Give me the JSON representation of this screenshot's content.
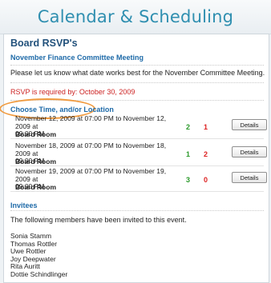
{
  "header": {
    "title": "Calendar & Scheduling"
  },
  "section": {
    "title": "Board RSVP's",
    "event_name": "November Finance Committee Meeting",
    "message": "Please let us know what date works best for the November Committee Meeting.",
    "rsvp_note": "RSVP is required by: October 30, 2009"
  },
  "choose": {
    "label": "Choose Time, and/or Location"
  },
  "options": [
    {
      "range_line1": "November 12, 2009 at 07:00 PM to November 12, 2009 at",
      "range_line2": "09:00 PM",
      "location": "Board Room",
      "yes": "2",
      "no": "1",
      "details_label": "Details"
    },
    {
      "range_line1": "November 18, 2009 at 07:00 PM to November 18, 2009 at",
      "range_line2": "09:00 PM",
      "location": "Board Room",
      "yes": "1",
      "no": "2",
      "details_label": "Details"
    },
    {
      "range_line1": "November 19, 2009 at 07:00 PM to November 19, 2009 at",
      "range_line2": "09:00 PM",
      "location": "Board Room",
      "yes": "3",
      "no": "0",
      "details_label": "Details"
    }
  ],
  "invitees": {
    "title": "Invitees",
    "intro": "The following members have been invited to this event.",
    "members": [
      "Sonia Stamm",
      "Thomas Rottler",
      "Uwe Rottler",
      "Joy Deepwater",
      "Rita Auritt",
      "Dottie Schindlinger"
    ]
  },
  "colors": {
    "accent": "#2f8fb0",
    "link": "#1e6aa8",
    "yes": "#2c9a2c",
    "no": "#dd2222",
    "highlight": "#f09a3e"
  }
}
